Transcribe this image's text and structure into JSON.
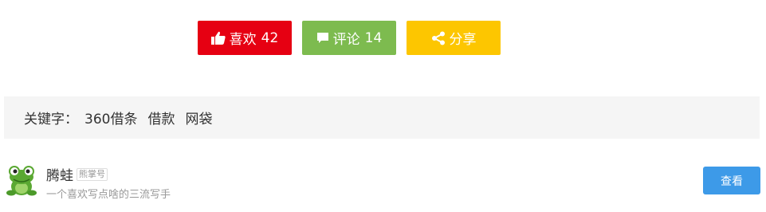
{
  "actions": {
    "like": {
      "label": "喜欢",
      "count": "42",
      "icon": "thumbs-up-icon",
      "color": "#e60012"
    },
    "comment": {
      "label": "评论",
      "count": "14",
      "icon": "comment-icon",
      "color": "#7dbb4f"
    },
    "share": {
      "label": "分享",
      "icon": "share-icon",
      "color": "#fdc600"
    }
  },
  "keywords": {
    "label": "关键字：",
    "tags": [
      "360借条",
      "借款",
      "网袋"
    ]
  },
  "author": {
    "name": "腾蛙",
    "badge": "熊掌号",
    "bio": "一个喜欢写点啥的三流写手",
    "avatar_icon": "frog-avatar-icon",
    "view_label": "查看",
    "view_color": "#3d9ae8"
  }
}
